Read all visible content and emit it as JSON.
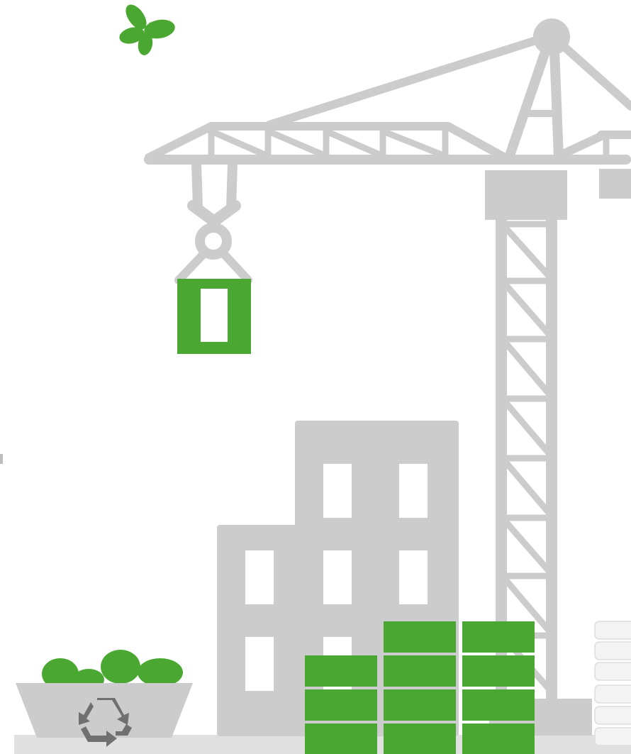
{
  "illustration": {
    "subject": "construction-site",
    "colors": {
      "structure_gray": "#cccccc",
      "window_white": "#ffffff",
      "accent_green": "#4aa832",
      "recycle_gray": "#707070",
      "ground_gray": "#e0e0e0",
      "background": "#ffffff"
    },
    "icons": [
      "butterfly-icon",
      "recycle-icon"
    ]
  }
}
